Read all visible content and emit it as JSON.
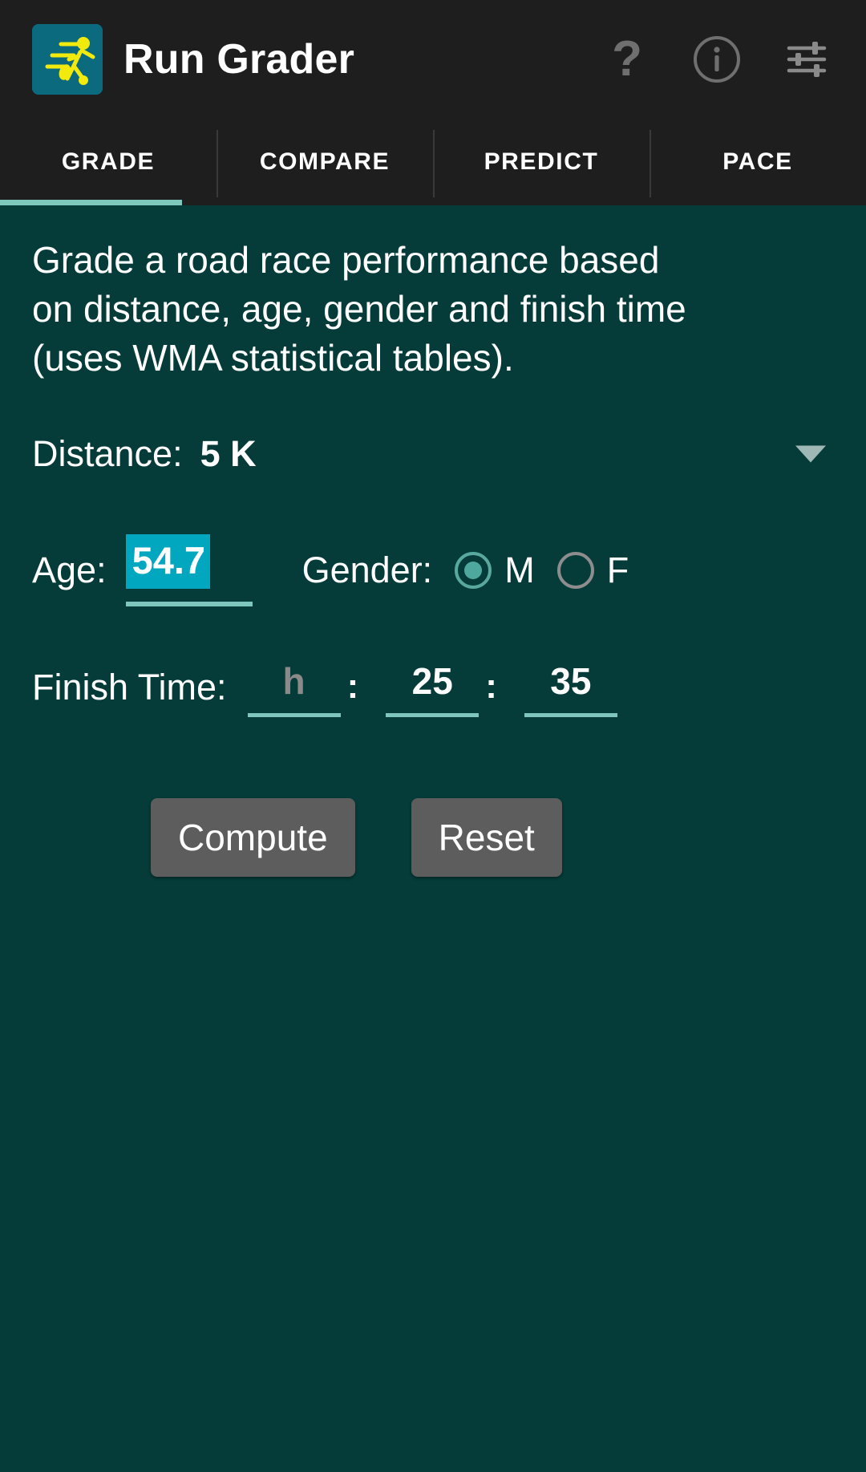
{
  "app": {
    "title": "Run Grader",
    "icon_name": "runner-app-icon",
    "icon_bg": "#0b6a7e",
    "icon_fg": "#f2ea0c"
  },
  "topbar": {
    "background": "#1e1e1e",
    "actions": [
      {
        "name": "help-icon",
        "glyph": "?"
      },
      {
        "name": "info-icon",
        "glyph": "i"
      },
      {
        "name": "settings-sliders-icon",
        "glyph": "sliders"
      }
    ]
  },
  "tabs": {
    "items": [
      {
        "label": "GRADE",
        "active": true
      },
      {
        "label": "COMPARE",
        "active": false
      },
      {
        "label": "PREDICT",
        "active": false
      },
      {
        "label": "PACE",
        "active": false
      }
    ],
    "indicator_color": "#7fc6bd"
  },
  "main": {
    "background": "#053b38",
    "description": "Grade a road race performance based on distance, age, gender and finish time (uses WMA statistical tables).",
    "distance": {
      "label": "Distance:",
      "value": "5 K",
      "options": [
        "5 K"
      ]
    },
    "age": {
      "label": "Age:",
      "value": "54.7",
      "selection_color": "#00a7bf",
      "underline_color": "#7fc6bd"
    },
    "gender": {
      "label": "Gender:",
      "options": [
        {
          "label": "M",
          "selected": true
        },
        {
          "label": "F",
          "selected": false
        }
      ],
      "selected_color": "#4fa89e",
      "unselected_color": "#8d8d8d"
    },
    "finish_time": {
      "label": "Finish Time:",
      "hours": {
        "value": "",
        "placeholder": "h"
      },
      "separator": ":",
      "minutes": {
        "value": "25",
        "placeholder": "m"
      },
      "seconds": {
        "value": "35",
        "placeholder": "s"
      }
    },
    "buttons": {
      "compute": "Compute",
      "reset": "Reset",
      "background": "#5d5d5d"
    }
  }
}
